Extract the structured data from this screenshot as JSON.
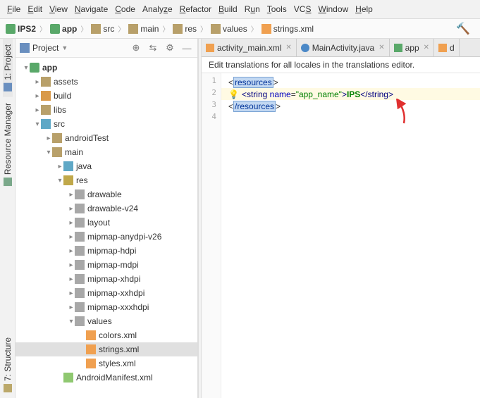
{
  "menu": [
    "File",
    "Edit",
    "View",
    "Navigate",
    "Code",
    "Analyze",
    "Refactor",
    "Build",
    "Run",
    "Tools",
    "VCS",
    "Window",
    "Help"
  ],
  "breadcrumb": [
    {
      "icon": "mod",
      "label": "IPS2",
      "bold": true
    },
    {
      "icon": "mod",
      "label": "app",
      "bold": true
    },
    {
      "icon": "fld",
      "label": "src"
    },
    {
      "icon": "fld",
      "label": "main"
    },
    {
      "icon": "fld",
      "label": "res"
    },
    {
      "icon": "fld",
      "label": "values"
    },
    {
      "icon": "xml",
      "label": "strings.xml"
    }
  ],
  "left_tabs": {
    "project": "1: Project",
    "resmgr": "Resource Manager",
    "structure": "7: Structure"
  },
  "project_header": {
    "combo": "Project",
    "mode": "▼",
    "buttons": [
      "target",
      "expand",
      "gear",
      "hide"
    ]
  },
  "tree": [
    {
      "d": 0,
      "exp": "open",
      "ic": "mod",
      "label": "app",
      "bold": true
    },
    {
      "d": 1,
      "exp": "closed",
      "ic": "fld-g",
      "label": "assets"
    },
    {
      "d": 1,
      "exp": "closed",
      "ic": "fld-o",
      "label": "build"
    },
    {
      "d": 1,
      "exp": "closed",
      "ic": "fld-g",
      "label": "libs"
    },
    {
      "d": 1,
      "exp": "open",
      "ic": "fld-b",
      "label": "src"
    },
    {
      "d": 2,
      "exp": "closed",
      "ic": "fld-g",
      "label": "androidTest"
    },
    {
      "d": 2,
      "exp": "open",
      "ic": "fld-g",
      "label": "main"
    },
    {
      "d": 3,
      "exp": "closed",
      "ic": "fld-b",
      "label": "java"
    },
    {
      "d": 3,
      "exp": "open",
      "ic": "fld-y",
      "label": "res"
    },
    {
      "d": 4,
      "exp": "closed",
      "ic": "fld-gry",
      "label": "drawable"
    },
    {
      "d": 4,
      "exp": "closed",
      "ic": "fld-gry",
      "label": "drawable-v24"
    },
    {
      "d": 4,
      "exp": "closed",
      "ic": "fld-gry",
      "label": "layout"
    },
    {
      "d": 4,
      "exp": "closed",
      "ic": "fld-gry",
      "label": "mipmap-anydpi-v26"
    },
    {
      "d": 4,
      "exp": "closed",
      "ic": "fld-gry",
      "label": "mipmap-hdpi"
    },
    {
      "d": 4,
      "exp": "closed",
      "ic": "fld-gry",
      "label": "mipmap-mdpi"
    },
    {
      "d": 4,
      "exp": "closed",
      "ic": "fld-gry",
      "label": "mipmap-xhdpi"
    },
    {
      "d": 4,
      "exp": "closed",
      "ic": "fld-gry",
      "label": "mipmap-xxhdpi"
    },
    {
      "d": 4,
      "exp": "closed",
      "ic": "fld-gry",
      "label": "mipmap-xxxhdpi"
    },
    {
      "d": 4,
      "exp": "open",
      "ic": "fld-gry",
      "label": "values"
    },
    {
      "d": 5,
      "exp": "none",
      "ic": "xml",
      "label": "colors.xml"
    },
    {
      "d": 5,
      "exp": "none",
      "ic": "xml",
      "label": "strings.xml",
      "sel": true
    },
    {
      "d": 5,
      "exp": "none",
      "ic": "xml",
      "label": "styles.xml"
    },
    {
      "d": 3,
      "exp": "none",
      "ic": "mf",
      "label": "AndroidManifest.xml"
    }
  ],
  "tabs": [
    {
      "icon": "xml",
      "label": "activity_main.xml",
      "active": false
    },
    {
      "icon": "java",
      "label": "MainActivity.java",
      "active": false
    },
    {
      "icon": "mod",
      "label": "app",
      "active": false
    },
    {
      "icon": "xml",
      "label": "d",
      "active": false,
      "cut": true
    }
  ],
  "hint": "Edit translations for all locales in the translations editor.",
  "code": {
    "lines": [
      "1",
      "2",
      "3",
      "4"
    ],
    "l1_tag": "resources",
    "l2_pre": "<",
    "l2_tag": "string",
    "l2_sp": " ",
    "l2_attr": "name",
    "l2_eq": "=",
    "l2_val": "\"app_name\"",
    "l2_gt": ">",
    "l2_txt": "IPS",
    "l2_ct": "</",
    "l2_ctag": "string",
    "l2_cgt": ">",
    "l3_tag": "/resources"
  }
}
